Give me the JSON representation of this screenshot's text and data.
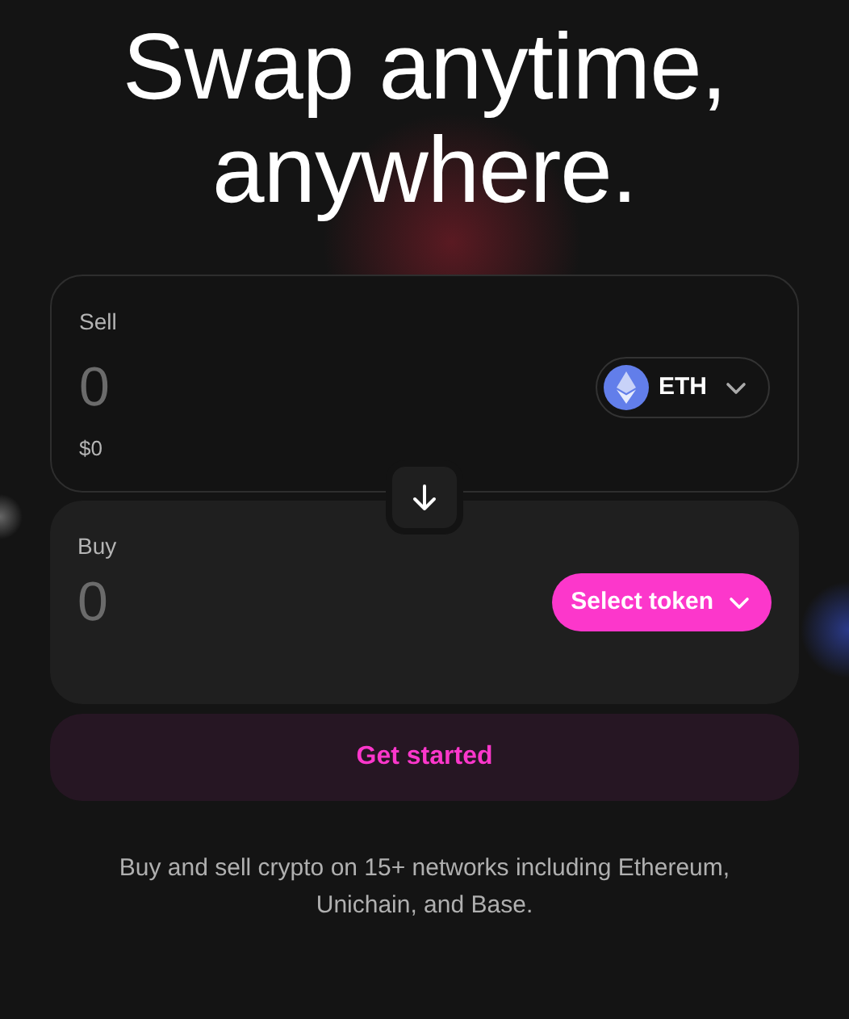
{
  "headline": [
    "Swap anytime,",
    "anywhere."
  ],
  "sell": {
    "label": "Sell",
    "placeholder": "0",
    "usd_value": "$0",
    "token": {
      "symbol": "ETH"
    }
  },
  "switch_button": {
    "kind": "arrow-down"
  },
  "buy": {
    "label": "Buy",
    "placeholder": "0",
    "token_button": "Select token"
  },
  "primary_button": "Get started",
  "footer": "Buy and sell crypto on 15+ networks including Ethereum, Unichain, and Base."
}
